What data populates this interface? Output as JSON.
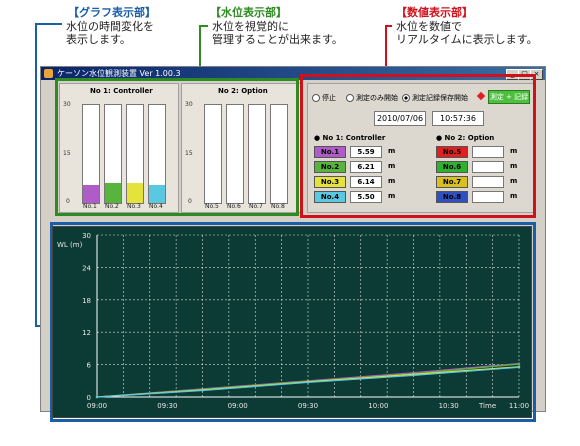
{
  "annotations": {
    "graph": {
      "title": "【グラフ表示部】",
      "desc": "水位の時間変化を\n表示します。",
      "color": "#1a5ea8"
    },
    "water": {
      "title": "【水位表示部】",
      "desc": "水位を視覚的に\n管理することが出来ます。",
      "color": "#2e8b1f"
    },
    "numeric": {
      "title": "【数値表示部】",
      "desc": "水位を数値で\nリアルタイムに表示します。",
      "color": "#d0101a"
    }
  },
  "window": {
    "title": "ケーソン水位観測装置  Ver 1.00.3",
    "buttons": [
      "_",
      "□",
      "×"
    ]
  },
  "bars_panel": {
    "controller": {
      "title": "No 1: Controller",
      "labels": [
        "No.1",
        "No.2",
        "No.3",
        "No.4"
      ],
      "levels": [
        5.59,
        6.21,
        6.14,
        5.5
      ],
      "colors": [
        "#b05cc8",
        "#58b43c",
        "#e6e23c",
        "#5ac8e0"
      ]
    },
    "option": {
      "title": "No 2: Option",
      "labels": [
        "No.5",
        "No.6",
        "No.7",
        "No.8"
      ],
      "levels": [
        0,
        0,
        0,
        0
      ]
    },
    "yticks": [
      "30",
      "15",
      "0"
    ],
    "ymax": 30
  },
  "numeric_panel": {
    "radios": [
      {
        "label": "停止",
        "selected": false
      },
      {
        "label": "測定のみ開始",
        "selected": false
      },
      {
        "label": "測定記録保存開始",
        "selected": true
      }
    ],
    "record_button": "測定 + 記録",
    "date": "2010/07/06",
    "time": "10:57:36",
    "controller": {
      "title": "No 1: Controller",
      "rows": [
        {
          "label": "No.1",
          "value": "5.59",
          "unit": "m",
          "color": "#b05cc8"
        },
        {
          "label": "No.2",
          "value": "6.21",
          "unit": "m",
          "color": "#58b43c"
        },
        {
          "label": "No.3",
          "value": "6.14",
          "unit": "m",
          "color": "#e6e23c"
        },
        {
          "label": "No.4",
          "value": "5.50",
          "unit": "m",
          "color": "#5ac8e0"
        }
      ]
    },
    "option": {
      "title": "No 2: Option",
      "rows": [
        {
          "label": "No.5",
          "value": "",
          "unit": "m",
          "color": "#e02020"
        },
        {
          "label": "No.6",
          "value": "",
          "unit": "m",
          "color": "#30b030"
        },
        {
          "label": "No.7",
          "value": "",
          "unit": "m",
          "color": "#d8c020"
        },
        {
          "label": "No.8",
          "value": "",
          "unit": "m",
          "color": "#3050c0"
        }
      ]
    }
  },
  "graph": {
    "ylabel": "WL (m)",
    "xlabel": "Time",
    "yticks": [
      "30",
      "24",
      "18",
      "12",
      "6",
      "0"
    ],
    "xticks": [
      "09:00",
      "09:30",
      "09:00",
      "09:30",
      "10:00",
      "10:30",
      "11:00"
    ],
    "background": "#0c3a34"
  },
  "chart_data": {
    "type": "line",
    "xlabel": "Time",
    "ylabel": "WL (m)",
    "ylim": [
      0,
      30
    ],
    "x": [
      "09:00",
      "09:30",
      "10:00",
      "10:30",
      "11:00"
    ],
    "series": [
      {
        "values": [
          0.0,
          1.5,
          3.0,
          4.5,
          6.2
        ],
        "color": "#b05cc8"
      },
      {
        "values": [
          0.0,
          1.4,
          2.9,
          4.3,
          6.1
        ],
        "color": "#58b43c"
      },
      {
        "values": [
          0.0,
          1.3,
          2.8,
          4.2,
          5.6
        ],
        "color": "#e6e23c"
      },
      {
        "values": [
          0.0,
          1.2,
          2.7,
          4.0,
          5.5
        ],
        "color": "#5ac8e0"
      }
    ],
    "grid": true
  }
}
